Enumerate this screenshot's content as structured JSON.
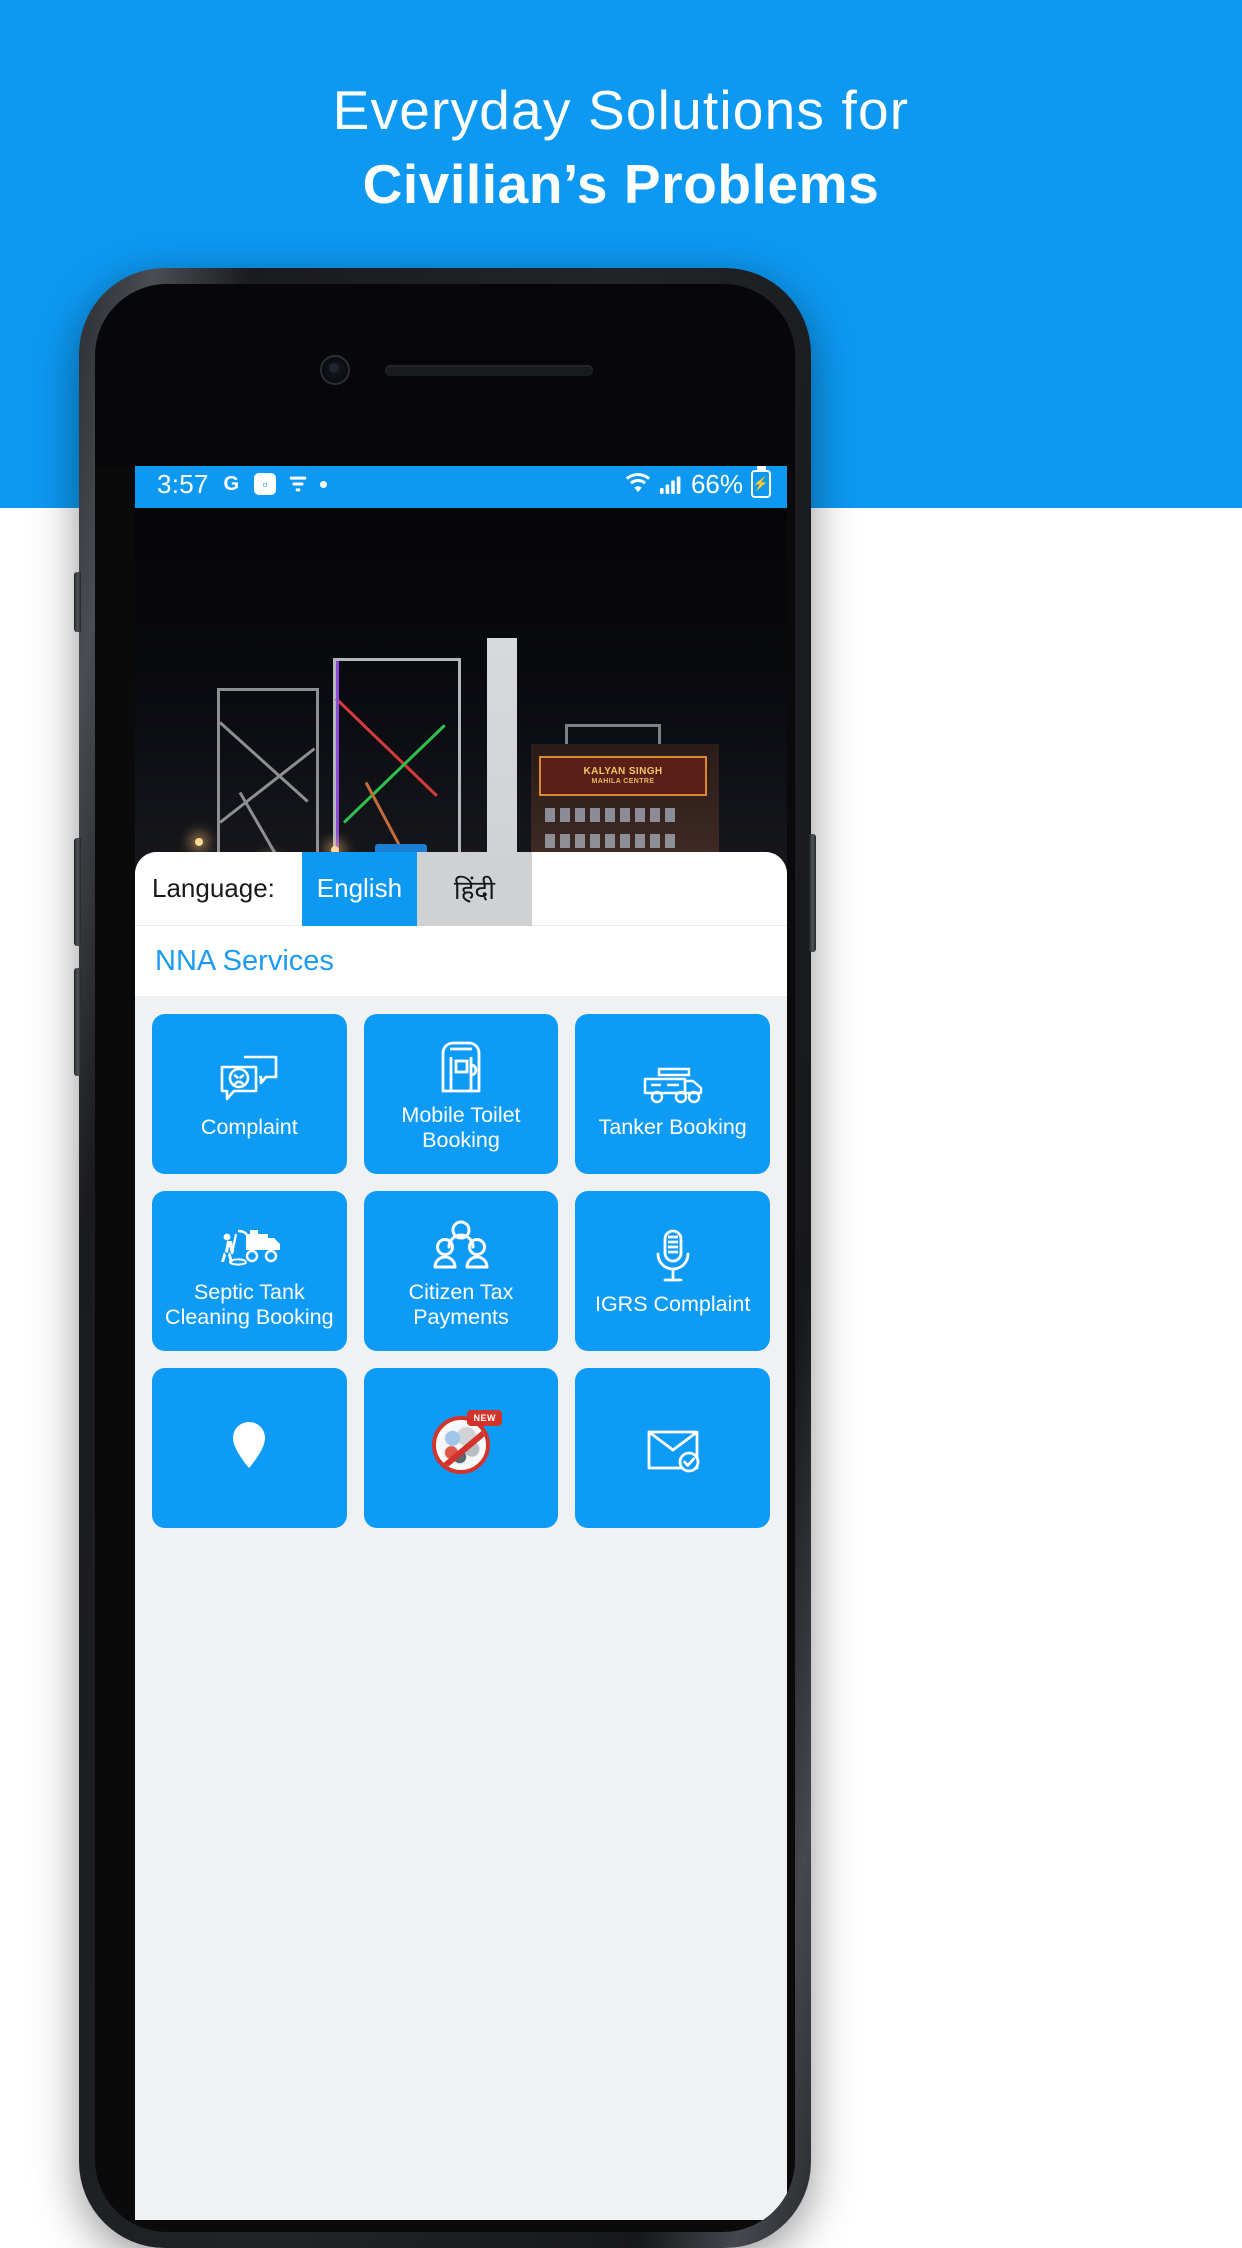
{
  "banner": {
    "headline_line1": "Everyday Solutions for",
    "headline_line2": "Civilian’s Problems",
    "bg_color": "#0d99f2",
    "text_color": "#ffffff"
  },
  "status_bar": {
    "time": "3:57",
    "icons": [
      "google-g-icon",
      "chat-bubble-icon",
      "filter-icon",
      "dot-icon"
    ],
    "wifi_icon": "wifi-icon",
    "signal_icon": "cellular-signal-icon",
    "battery_percent": "66%",
    "battery_icon": "battery-charging-icon",
    "bg_color": "#0d99f2"
  },
  "hero": {
    "sign_title": "KALYAN SINGH",
    "sign_subtitle": "MAHILA CENTRE"
  },
  "language": {
    "label": "Language:",
    "options": [
      {
        "label": "English",
        "active": true
      },
      {
        "label": "हिंदी",
        "active": false
      }
    ],
    "active_color": "#0d99f2",
    "inactive_color": "#cfd1d3"
  },
  "services_section": {
    "title": "NNA Services",
    "title_color": "#1d9bf0",
    "tile_color": "#0d9bf5",
    "grid_bg": "#f0f1f2",
    "tiles": [
      {
        "label": "Complaint",
        "icon": "complaint-chat-sad-face-icon"
      },
      {
        "label": "Mobile Toilet Booking",
        "icon": "mobile-toilet-icon"
      },
      {
        "label": "Tanker Booking",
        "icon": "water-tanker-truck-icon"
      },
      {
        "label": "Septic Tank Cleaning Booking",
        "icon": "septic-tank-truck-worker-icon"
      },
      {
        "label": "Citizen Tax Payments",
        "icon": "group-of-people-icon"
      },
      {
        "label": "IGRS Complaint",
        "icon": "microphone-icon"
      },
      {
        "label": "",
        "icon": "location-pin-people-icon"
      },
      {
        "label": "",
        "icon": "plastic-ban-icon",
        "badge": "NEW"
      },
      {
        "label": "",
        "icon": "document-check-icon"
      }
    ]
  }
}
